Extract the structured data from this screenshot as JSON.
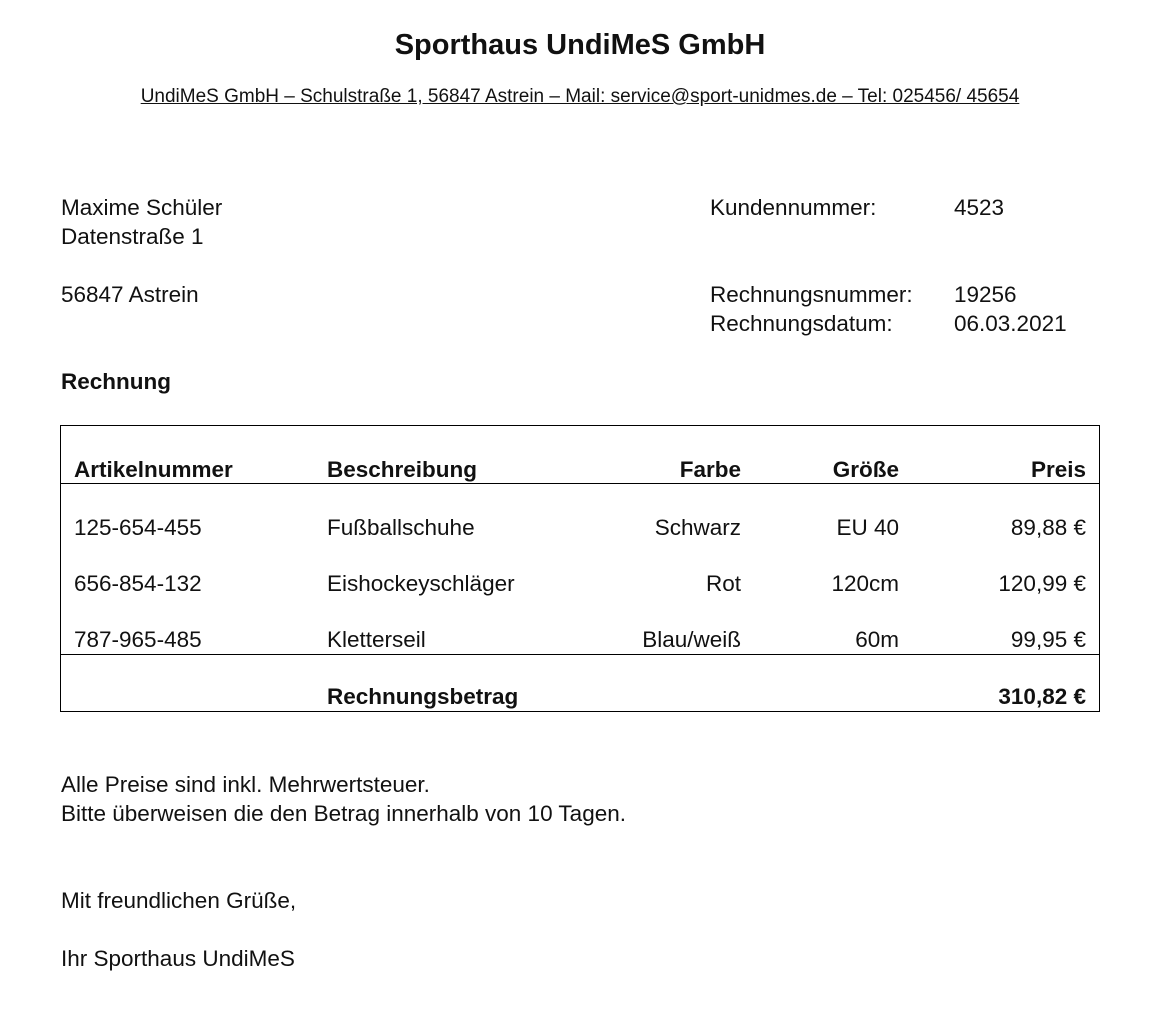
{
  "header": {
    "company_name": "Sporthaus UndiMeS GmbH",
    "address_line": "UndiMeS GmbH – Schulstraße 1, 56847 Astrein – Mail: service@sport-unidmes.de – Tel: 025456/ 45654"
  },
  "recipient": {
    "name": "Maxime Schüler",
    "street": "Datenstraße 1",
    "city": "56847 Astrein"
  },
  "meta": {
    "customer_number_label": "Kundennummer:",
    "customer_number": "4523",
    "invoice_number_label": "Rechnungsnummer:",
    "invoice_number": "19256",
    "invoice_date_label": "Rechnungsdatum:",
    "invoice_date": "06.03.2021"
  },
  "invoice_heading": "Rechnung",
  "table": {
    "headers": {
      "article": "Artikelnummer",
      "description": "Beschreibung",
      "color": "Farbe",
      "size": "Größe",
      "price": "Preis"
    },
    "rows": [
      {
        "article": "125-654-455",
        "description": "Fußballschuhe",
        "color": "Schwarz",
        "size": "EU 40",
        "price": "89,88 €"
      },
      {
        "article": "656-854-132",
        "description": "Eishockeyschläger",
        "color": "Rot",
        "size": "120cm",
        "price": "120,99 €"
      },
      {
        "article": "787-965-485",
        "description": "Kletterseil",
        "color": "Blau/weiß",
        "size": "60m",
        "price": "99,95 €"
      }
    ],
    "total_label": "Rechnungsbetrag",
    "total_value": "310,82 €"
  },
  "notes": {
    "line1": "Alle Preise sind inkl. Mehrwertsteuer.",
    "line2": "Bitte überweisen die den Betrag innerhalb von 10 Tagen."
  },
  "closing": {
    "greeting": "Mit freundlichen Grüße,",
    "signature": "Ihr Sporthaus UndiMeS"
  }
}
